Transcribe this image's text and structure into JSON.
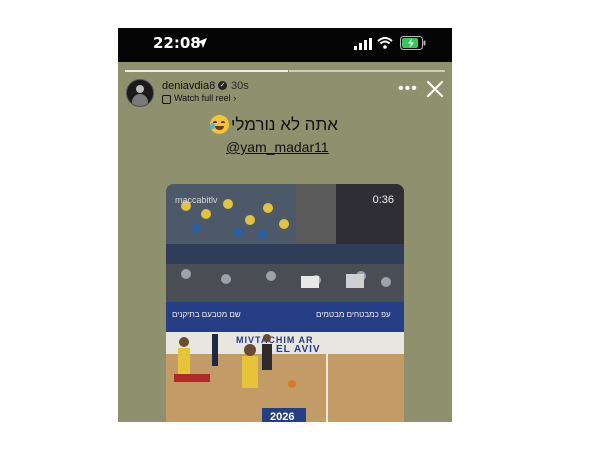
{
  "status_bar": {
    "time": "22:08",
    "icons": [
      "location-arrow-icon",
      "cellular-signal-icon",
      "wifi-icon",
      "battery-charging-icon"
    ]
  },
  "story": {
    "username": "deniavdia8",
    "time_ago": "30s",
    "watch_reel_label": "Watch full reel",
    "caption_hebrew": "אתה לא נורמלי",
    "caption_emoji": "crying-laughing-emoji",
    "mention": "@yam_madar11"
  },
  "video": {
    "watermark": "maccabitlv",
    "timer": "0:36",
    "board_text_left": "שם מטבעם בתיקנים",
    "board_text_right": "עפ כמבטחים מבטמים",
    "floor_banner_1": "MIVTACHIM AR",
    "floor_banner_2": "EL AVIV",
    "floor_year": "2026"
  },
  "colors": {
    "story_background": "#8e906e",
    "status_bar": "#050505",
    "battery_green": "#34c759"
  }
}
